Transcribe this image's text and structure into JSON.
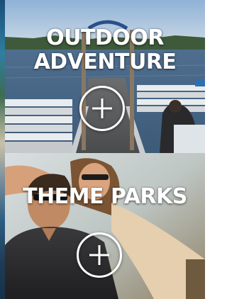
{
  "tiles": [
    {
      "title_line1": "OUTDOOR",
      "title_line2": "ADVENTURE",
      "button_icon": "plus-icon"
    },
    {
      "title_line1": "THEME PARKS",
      "button_icon": "plus-icon"
    }
  ],
  "colors": {
    "title_text": "#ffffff",
    "button_ring": "#ffffff"
  }
}
